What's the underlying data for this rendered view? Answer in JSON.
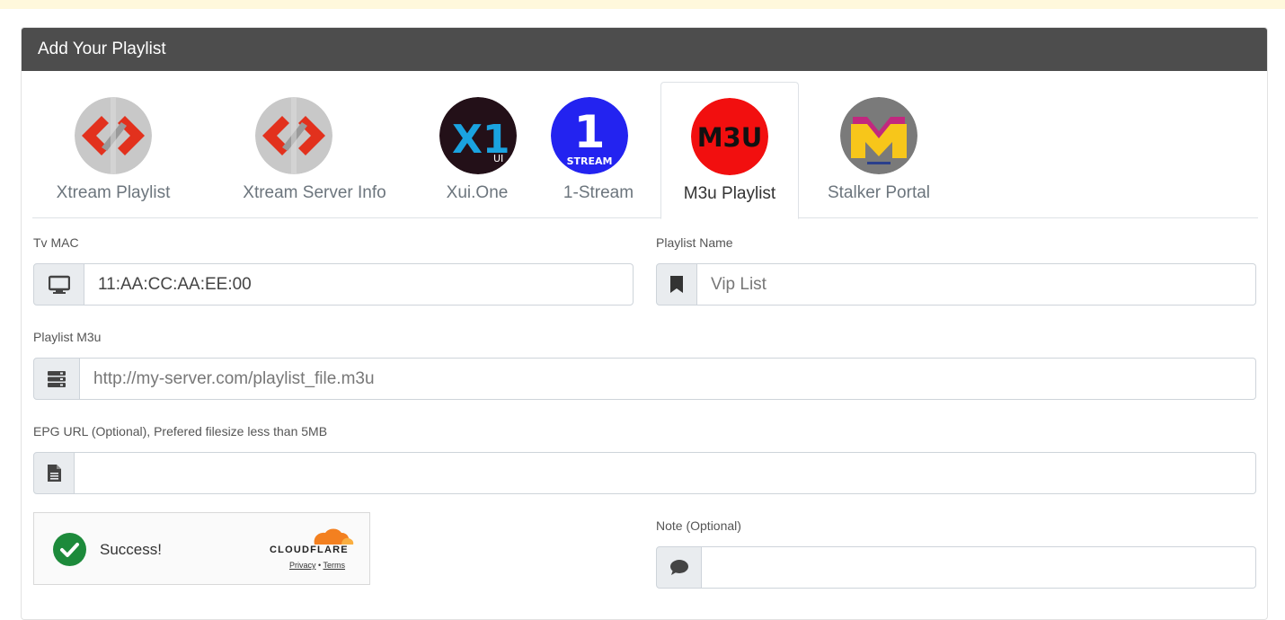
{
  "card": {
    "title": "Add Your Playlist"
  },
  "tabs": [
    {
      "label": "Xtream Playlist",
      "icon": "xtream-logo-icon"
    },
    {
      "label": "Xtream Server Info",
      "icon": "xtream-logo-icon"
    },
    {
      "label": "Xui.One",
      "icon": "xui-one-logo-icon",
      "logo_text": "X1",
      "logo_sub": "UI"
    },
    {
      "label": "1-Stream",
      "icon": "one-stream-logo-icon",
      "logo_text": "1",
      "logo_sub": "STREAM"
    },
    {
      "label": "M3u Playlist",
      "icon": "m3u-logo-icon",
      "logo_text": "M3U",
      "active": true
    },
    {
      "label": "Stalker Portal",
      "icon": "stalker-portal-logo-icon",
      "logo_text": "M"
    }
  ],
  "form": {
    "tv_mac": {
      "label": "Tv MAC",
      "value": "11:AA:CC:AA:EE:00",
      "icon": "monitor-icon"
    },
    "playlist_name": {
      "label": "Playlist Name",
      "placeholder": "Vip List",
      "icon": "bookmark-icon"
    },
    "playlist_m3u": {
      "label": "Playlist M3u",
      "placeholder": "http://my-server.com/playlist_file.m3u",
      "icon": "server-icon"
    },
    "epg_url": {
      "label": "EPG URL (Optional), Prefered filesize less than 5MB",
      "placeholder": "",
      "icon": "file-icon"
    },
    "note": {
      "label": "Note (Optional)",
      "placeholder": "",
      "icon": "comment-icon"
    }
  },
  "captcha": {
    "status": "Success!",
    "brand": "CLOUDFLARE",
    "privacy": "Privacy",
    "separator": "•",
    "terms": "Terms"
  },
  "colors": {
    "header_bg": "#4d4d4d",
    "success_green": "#1d8a3b",
    "cloudflare_orange": "#f38020"
  }
}
